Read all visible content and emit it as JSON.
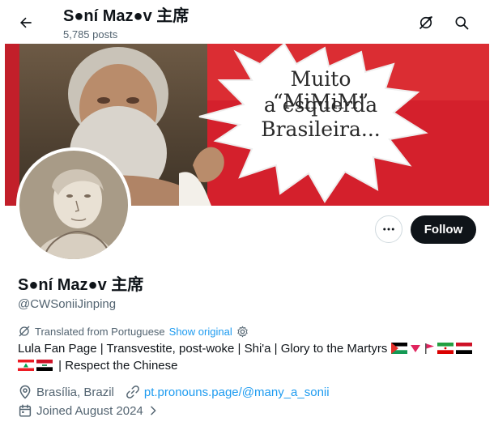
{
  "header": {
    "title": "S●ní Maz●v 主席",
    "posts_count": "5,785 posts"
  },
  "banner": {
    "caption_line1": "Muito “MiMiM”",
    "caption_line2": "a esquerda",
    "caption_line3": "Brasileira..."
  },
  "profile": {
    "display_name": "S●ní Maz●v 主席",
    "handle": "@CWSoniiJinping",
    "follow_label": "Follow",
    "translated_label": "Translated from Portuguese",
    "show_original_label": "Show original",
    "bio_line1": "Lula Fan Page | Transvestite, post-woke | Shi'a | Glory to the Martyrs",
    "bio_line2": "| Respect the Chinese",
    "location": "Brasília, Brazil",
    "website": "pt.pronouns.page/@many_a_sonii",
    "joined": "Joined August 2024"
  },
  "icons": [
    "back-arrow-icon",
    "translate-icon",
    "search-icon",
    "more-icon",
    "location-pin-icon",
    "link-icon",
    "calendar-icon",
    "chevron-right-icon",
    "gear-icon"
  ],
  "colors": {
    "accent": "#1d9bf0",
    "text": "#0f1419",
    "muted": "#536471",
    "button": "#0f1419"
  }
}
